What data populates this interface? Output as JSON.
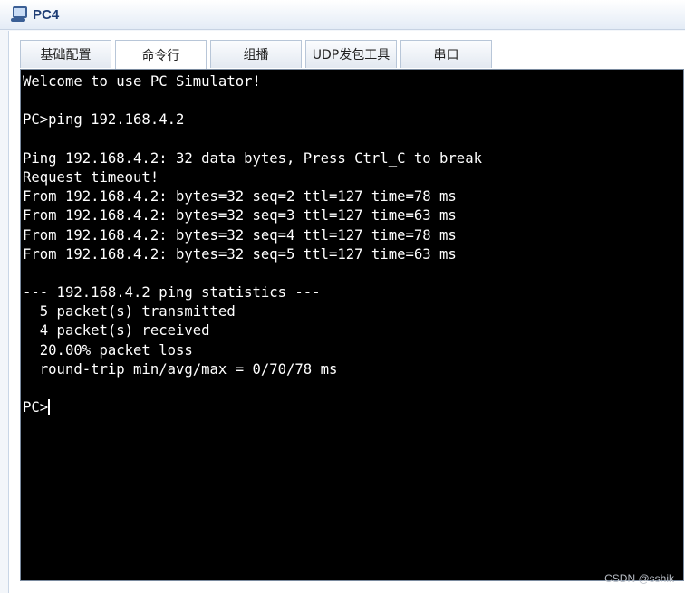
{
  "window": {
    "title": "PC4"
  },
  "tabs": [
    {
      "label": "基础配置",
      "width": 100
    },
    {
      "label": "命令行",
      "width": 100
    },
    {
      "label": "组播",
      "width": 100
    },
    {
      "label": "UDP发包工具",
      "width": 100
    },
    {
      "label": "串口",
      "width": 100
    }
  ],
  "active_tab": "命令行",
  "terminal": {
    "lines": [
      "Welcome to use PC Simulator!",
      "",
      "PC>ping 192.168.4.2",
      "",
      "Ping 192.168.4.2: 32 data bytes, Press Ctrl_C to break",
      "Request timeout!",
      "From 192.168.4.2: bytes=32 seq=2 ttl=127 time=78 ms",
      "From 192.168.4.2: bytes=32 seq=3 ttl=127 time=63 ms",
      "From 192.168.4.2: bytes=32 seq=4 ttl=127 time=78 ms",
      "From 192.168.4.2: bytes=32 seq=5 ttl=127 time=63 ms",
      "",
      "--- 192.168.4.2 ping statistics ---",
      "  5 packet(s) transmitted",
      "  4 packet(s) received",
      "  20.00% packet loss",
      "  round-trip min/avg/max = 0/70/78 ms",
      ""
    ],
    "prompt": "PC>"
  },
  "watermark": "CSDN @sshik",
  "colors": {
    "terminal_bg": "#000000",
    "terminal_fg": "#ffffff",
    "title_text": "#1e3d75"
  }
}
